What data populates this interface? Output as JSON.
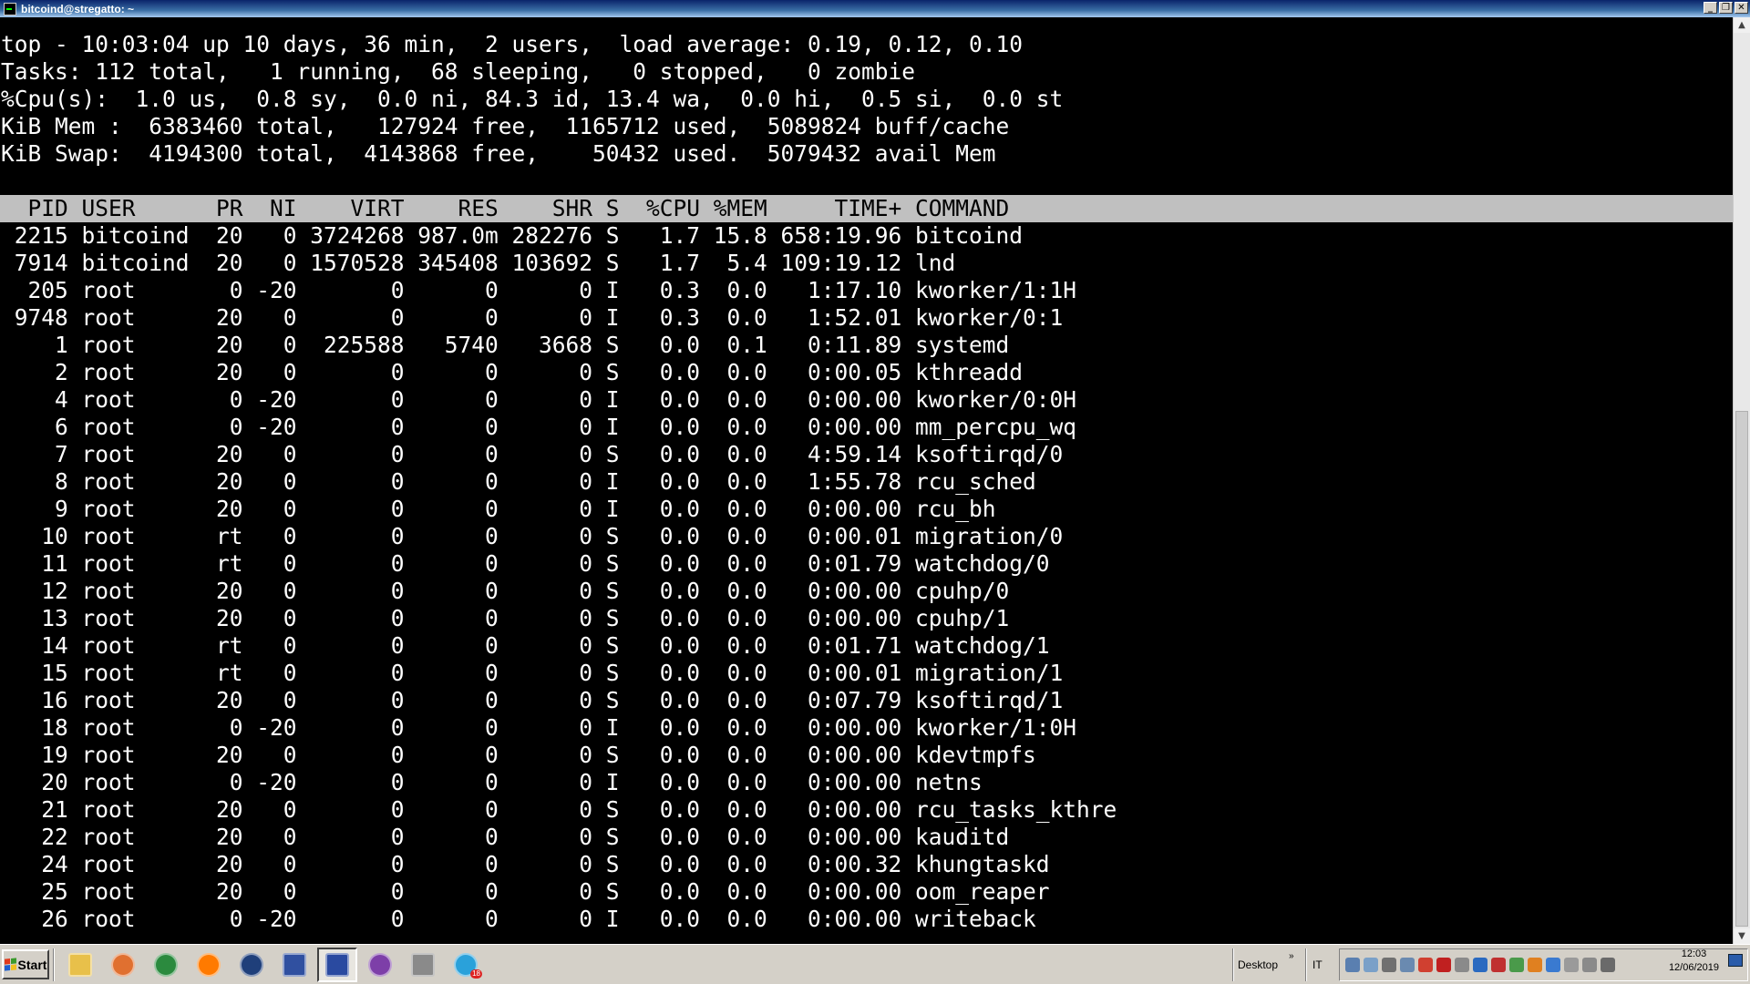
{
  "window": {
    "title": "bitcoind@stregatto: ~",
    "min_glyph": "_",
    "max_glyph": "❐",
    "close_glyph": "✕"
  },
  "top": {
    "summary": [
      "top - 10:03:04 up 10 days, 36 min,  2 users,  load average: 0.19, 0.12, 0.10",
      "Tasks: 112 total,   1 running,  68 sleeping,   0 stopped,   0 zombie",
      "%Cpu(s):  1.0 us,  0.8 sy,  0.0 ni, 84.3 id, 13.4 wa,  0.0 hi,  0.5 si,  0.0 st",
      "KiB Mem :  6383460 total,   127924 free,  1165712 used,  5089824 buff/cache",
      "KiB Swap:  4194300 total,  4143868 free,    50432 used.  5079432 avail Mem"
    ],
    "header": "  PID USER      PR  NI    VIRT    RES    SHR S  %CPU %MEM     TIME+ COMMAND                                                                                                                                        ",
    "processes": [
      " 2215 bitcoind  20   0 3724268 987.0m 282276 S   1.7 15.8 658:19.96 bitcoind",
      " 7914 bitcoind  20   0 1570528 345408 103692 S   1.7  5.4 109:19.12 lnd",
      "  205 root       0 -20       0      0      0 I   0.3  0.0   1:17.10 kworker/1:1H",
      " 9748 root      20   0       0      0      0 I   0.3  0.0   1:52.01 kworker/0:1",
      "    1 root      20   0  225588   5740   3668 S   0.0  0.1   0:11.89 systemd",
      "    2 root      20   0       0      0      0 S   0.0  0.0   0:00.05 kthreadd",
      "    4 root       0 -20       0      0      0 I   0.0  0.0   0:00.00 kworker/0:0H",
      "    6 root       0 -20       0      0      0 I   0.0  0.0   0:00.00 mm_percpu_wq",
      "    7 root      20   0       0      0      0 S   0.0  0.0   4:59.14 ksoftirqd/0",
      "    8 root      20   0       0      0      0 I   0.0  0.0   1:55.78 rcu_sched",
      "    9 root      20   0       0      0      0 I   0.0  0.0   0:00.00 rcu_bh",
      "   10 root      rt   0       0      0      0 S   0.0  0.0   0:00.01 migration/0",
      "   11 root      rt   0       0      0      0 S   0.0  0.0   0:01.79 watchdog/0",
      "   12 root      20   0       0      0      0 S   0.0  0.0   0:00.00 cpuhp/0",
      "   13 root      20   0       0      0      0 S   0.0  0.0   0:00.00 cpuhp/1",
      "   14 root      rt   0       0      0      0 S   0.0  0.0   0:01.71 watchdog/1",
      "   15 root      rt   0       0      0      0 S   0.0  0.0   0:00.01 migration/1",
      "   16 root      20   0       0      0      0 S   0.0  0.0   0:07.79 ksoftirqd/1",
      "   18 root       0 -20       0      0      0 I   0.0  0.0   0:00.00 kworker/1:0H",
      "   19 root      20   0       0      0      0 S   0.0  0.0   0:00.00 kdevtmpfs",
      "   20 root       0 -20       0      0      0 I   0.0  0.0   0:00.00 netns",
      "   21 root      20   0       0      0      0 S   0.0  0.0   0:00.00 rcu_tasks_kthre",
      "   22 root      20   0       0      0      0 S   0.0  0.0   0:00.00 kauditd",
      "   24 root      20   0       0      0      0 S   0.0  0.0   0:00.32 khungtaskd",
      "   25 root      20   0       0      0      0 S   0.0  0.0   0:00.00 oom_reaper",
      "   26 root       0 -20       0      0      0 I   0.0  0.0   0:00.00 writeback"
    ]
  },
  "scrollbar": {
    "up_glyph": "▲",
    "down_glyph": "▼"
  },
  "taskbar": {
    "start_label": "Start",
    "quick_launch": [
      {
        "name": "file-explorer-icon",
        "color": "#e8c04a"
      },
      {
        "name": "media-player-icon",
        "color": "#e07030"
      },
      {
        "name": "chrome-icon",
        "color": "#2b8a3e"
      },
      {
        "name": "firefox-icon",
        "color": "#ff7a00"
      },
      {
        "name": "app-circle-icon",
        "color": "#1f3f7a"
      },
      {
        "name": "virtualbox-icon",
        "color": "#3050a0"
      },
      {
        "name": "putty-icon",
        "color": "#2a4aa0"
      },
      {
        "name": "tor-browser-icon",
        "color": "#7d3fa8"
      },
      {
        "name": "network-printer-icon",
        "color": "#8a8a8a"
      },
      {
        "name": "telegram-icon",
        "color": "#2aa1da"
      }
    ],
    "telegram_badge": "18",
    "desktop_label": "Desktop",
    "desktop_chevron": "»",
    "language": "IT",
    "tray_icons": [
      {
        "name": "tray-network-icon",
        "color": "#5a7fb0"
      },
      {
        "name": "tray-monitor-icon",
        "color": "#7aa0c8"
      },
      {
        "name": "tray-usb-icon",
        "color": "#707070"
      },
      {
        "name": "tray-cloud-icon",
        "color": "#6a8ab0"
      },
      {
        "name": "tray-chrome-icon",
        "color": "#d04030"
      },
      {
        "name": "tray-k-icon",
        "color": "#c02020"
      },
      {
        "name": "tray-window-icon",
        "color": "#8a8a8a"
      },
      {
        "name": "tray-display-icon",
        "color": "#2a6ac0"
      },
      {
        "name": "tray-antivirus-icon",
        "color": "#c03030"
      },
      {
        "name": "tray-check-icon",
        "color": "#4a9a4a"
      },
      {
        "name": "tray-orange-icon",
        "color": "#e08020"
      },
      {
        "name": "tray-dropbox-icon",
        "color": "#3a7ad0"
      },
      {
        "name": "tray-flag-icon",
        "color": "#9a9a9a"
      },
      {
        "name": "tray-printer-icon",
        "color": "#8a8a8a"
      },
      {
        "name": "tray-volume-icon",
        "color": "#6a6a6a"
      }
    ],
    "clock_time": "12:03",
    "clock_date": "12/06/2019"
  }
}
